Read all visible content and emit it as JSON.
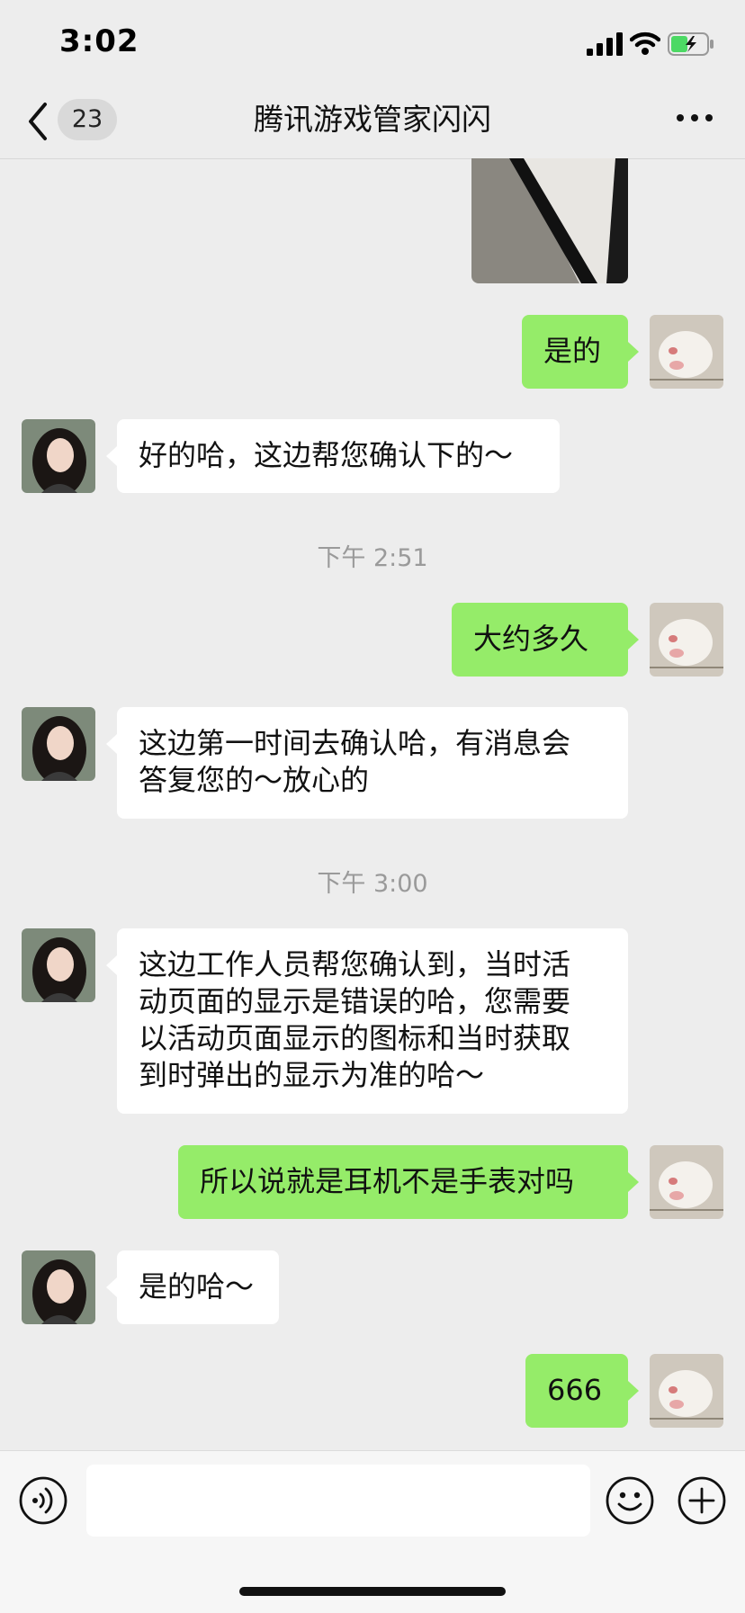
{
  "status_bar": {
    "time": "3:02",
    "battery_color": "#4cd964"
  },
  "nav": {
    "back_icon": "chevron-left-icon",
    "unread_count": "23",
    "title": "腾讯游戏管家闪闪",
    "more_icon": "ellipsis-icon"
  },
  "colors": {
    "outgoing_bubble": "#95ec69",
    "incoming_bubble": "#ffffff",
    "background": "#ededed"
  },
  "messages": {
    "m1_out": "是的",
    "m2_in": "好的哈，这边帮您确认下的～",
    "ts1": "下午 2:51",
    "m3_out": "大约多久",
    "m4_in": "这边第一时间去确认哈，有消息会\n答复您的～放心的",
    "ts2": "下午 3:00",
    "m5_in": "这边工作人员帮您确认到，当时活\n动页面的显示是错误的哈，您需要\n以活动页面显示的图标和当时获取\n到时弹出的显示为准的哈～",
    "m6_out": "所以说就是耳机不是手表对吗",
    "m7_in": "是的哈～",
    "m8_out": "666"
  },
  "input_bar": {
    "voice_icon": "voice-icon",
    "input_value": "",
    "emoji_icon": "emoji-icon",
    "plus_icon": "plus-icon"
  }
}
